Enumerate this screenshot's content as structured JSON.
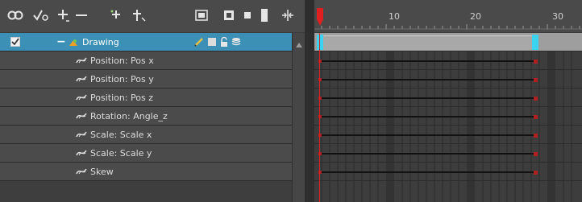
{
  "toolbar": {
    "icons": [
      "onion-skin-icon",
      "show-function-icon",
      "add-layer-icon",
      "delete-layer-icon",
      "add-effect-icon",
      "add-peg-icon",
      "layer-view-icon",
      "toggle-square-icon",
      "toggle-small-square-icon",
      "toggle-bar-icon",
      "fit-icon"
    ]
  },
  "layers": {
    "main": {
      "name": "Drawing",
      "checked": true,
      "collapse_symbol": "−"
    },
    "functions": [
      "Position: Pos x",
      "Position: Pos y",
      "Position: Pos z",
      "Rotation: Angle_z",
      "Scale: Scale x",
      "Scale: Scale y",
      "Skew"
    ]
  },
  "timeline": {
    "ticks": [
      "10",
      "20",
      "30"
    ]
  },
  "colors": {
    "selection": "#3c8fb5",
    "playhead": "#e02020",
    "keyframe": "#b02020",
    "cyan": "#3bd3f0"
  }
}
